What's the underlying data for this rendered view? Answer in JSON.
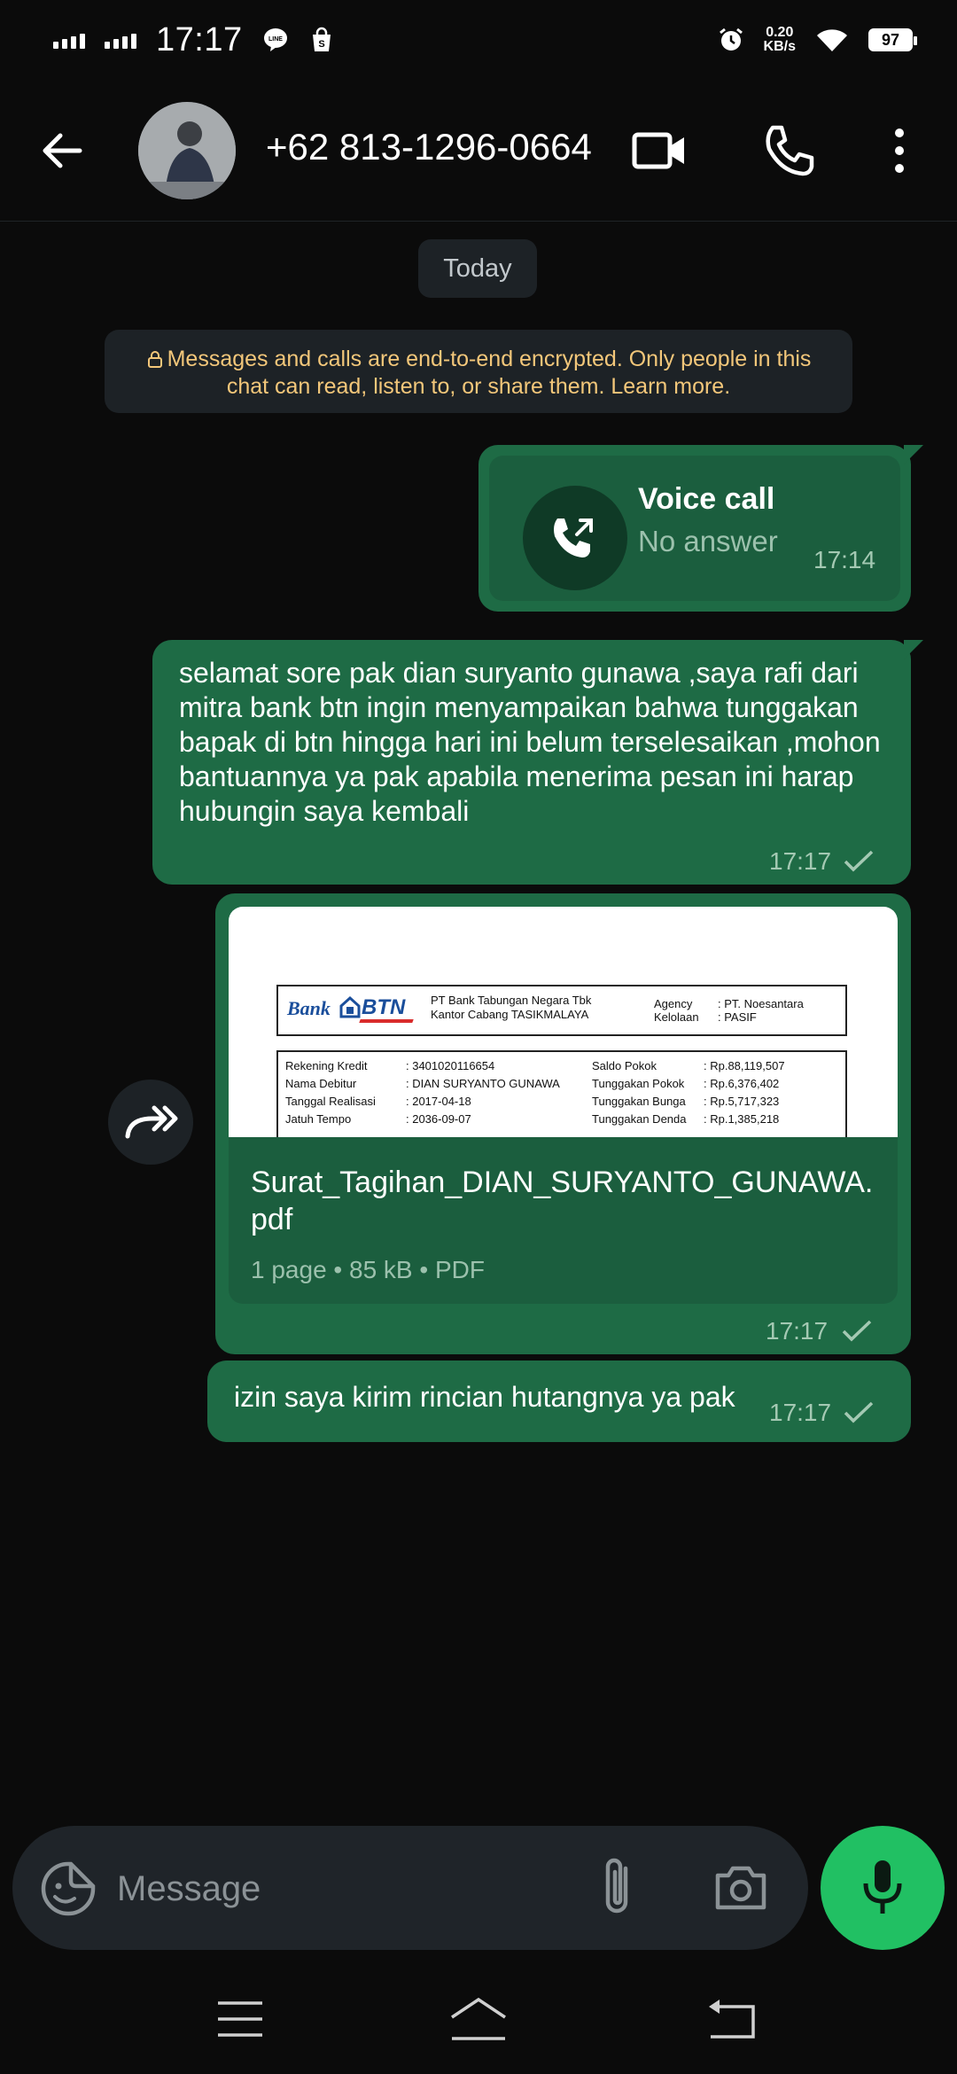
{
  "status_bar": {
    "time": "17:17",
    "net_speed_value": "0.20",
    "net_speed_unit": "KB/s",
    "battery": "97"
  },
  "header": {
    "contact": "+62 813-1296-0664",
    "icons": [
      "back-arrow-icon",
      "video-camera-icon",
      "phone-icon",
      "more-vertical-icon"
    ]
  },
  "chat": {
    "date_label": "Today",
    "encryption_notice": "Messages and calls are end-to-end encrypted. Only people in this chat can read, listen to, or share them. Learn more.",
    "voice_call": {
      "title": "Voice call",
      "status": "No answer",
      "time": "17:14"
    },
    "message_1": {
      "text": "selamat sore pak dian suryanto gunawa ,saya rafi dari mitra bank btn ingin menyampaikan bahwa tunggakan bapak di btn hingga hari ini belum terselesaikan ,mohon bantuannya ya pak apabila menerima pesan ini harap hubungin saya kembali",
      "time": "17:17"
    },
    "document": {
      "file_name": "Surat_Tagihan_DIAN_SURYANTO_GUNAWA.pdf",
      "meta": "1 page • 85 kB • PDF",
      "time": "17:17",
      "preview": {
        "bank_word": "Bank",
        "bank_brand": "BTN",
        "org_line_1": "PT Bank Tabungan Negara Tbk",
        "org_line_2": "Kantor Cabang TASIKMALAYA",
        "agency_label": "Agency",
        "agency_value": ": PT. Noesantara",
        "kelolaan_label": "Kelolaan",
        "kelolaan_value": ": PASIF",
        "rows_left": [
          {
            "label": "Rekening Kredit",
            "value": ": 3401020116654"
          },
          {
            "label": "Nama Debitur",
            "value": ": DIAN SURYANTO GUNAWA"
          },
          {
            "label": "Tanggal Realisasi",
            "value": ": 2017-04-18"
          },
          {
            "label": "Jatuh Tempo",
            "value": ": 2036-09-07"
          }
        ],
        "rows_right": [
          {
            "label": "Saldo Pokok",
            "value": ": Rp.88,119,507"
          },
          {
            "label": "Tunggakan Pokok",
            "value": ": Rp.6,376,402"
          },
          {
            "label": "Tunggakan Bunga",
            "value": ": Rp.5,717,323"
          },
          {
            "label": "Tunggakan Denda",
            "value": ": Rp.1,385,218"
          }
        ]
      }
    },
    "message_2": {
      "text": "izin saya kirim rincian hutangnya ya pak",
      "time": "17:17"
    }
  },
  "composer": {
    "placeholder": "Message",
    "icons": [
      "sticker-icon",
      "paperclip-icon",
      "camera-icon",
      "microphone-icon"
    ]
  },
  "colors": {
    "background": "#0b0b0b",
    "outgoing_bubble": "#1e6b45",
    "accent_green": "#21c063",
    "notice_text": "#f3c77a"
  }
}
